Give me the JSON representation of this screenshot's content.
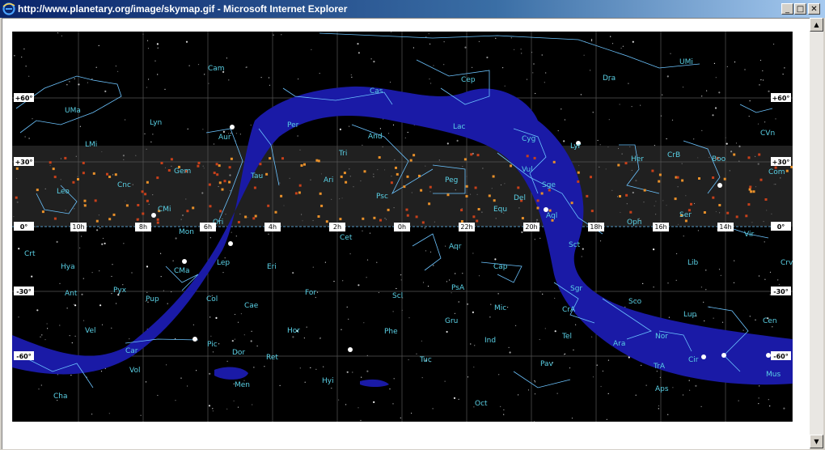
{
  "window": {
    "title": "http://www.planetary.org/image/skymap.gif - Microsoft Internet Explorer",
    "minimize": "_",
    "maximize": "□",
    "close": "✕"
  },
  "scrollbar": {
    "up": "▲",
    "down": "▼"
  },
  "skymap": {
    "dec_labels": [
      "+60°",
      "+30°",
      "0°",
      "-30°",
      "-60°"
    ],
    "ra_labels": [
      "10h",
      "8h",
      "6h",
      "4h",
      "2h",
      "0h",
      "22h",
      "20h",
      "18h",
      "16h",
      "14h"
    ],
    "constellations": [
      "Cam",
      "UMa",
      "Lyn",
      "LMi",
      "Leo",
      "Cnc",
      "Gem",
      "CMi",
      "Aur",
      "Per",
      "Cas",
      "Tri",
      "And",
      "Ari",
      "Tau",
      "Psc",
      "Peg",
      "Lac",
      "Cep",
      "UMi",
      "Dra",
      "Cyg",
      "Lyr",
      "Vul",
      "Sge",
      "Del",
      "Equ",
      "Aql",
      "Her",
      "CrB",
      "Boo",
      "CVn",
      "Com",
      "Ser",
      "Oph",
      "Vir",
      "Lib",
      "Crv",
      "Crt",
      "Hya",
      "Ant",
      "Pyx",
      "Mon",
      "Ori",
      "CMa",
      "Lep",
      "Eri",
      "Col",
      "Pup",
      "Cae",
      "For",
      "Scl",
      "PsA",
      "Cet",
      "Aqr",
      "Cap",
      "Mic",
      "Gru",
      "Sgr",
      "CrA",
      "Sct",
      "Sco",
      "Lup",
      "Cen",
      "Nor",
      "Ara",
      "TrA",
      "Cir",
      "Mus",
      "Aps",
      "Pav",
      "Ind",
      "Tel",
      "Tuc",
      "Phe",
      "Hor",
      "Ret",
      "Dor",
      "Pic",
      "Vel",
      "Car",
      "Vol",
      "Cha",
      "Men",
      "Hyi",
      "Oct"
    ]
  },
  "colors": {
    "titlebar_start": "#0a246a",
    "titlebar_end": "#a6caf0",
    "sky": "#000000",
    "milky_way": "#1a1aa6",
    "constellation_line": "#6cc4ff",
    "label": "#5ad1e6",
    "ecliptic_band": "#3a3a3a",
    "planet_marker": "#e8902a"
  }
}
